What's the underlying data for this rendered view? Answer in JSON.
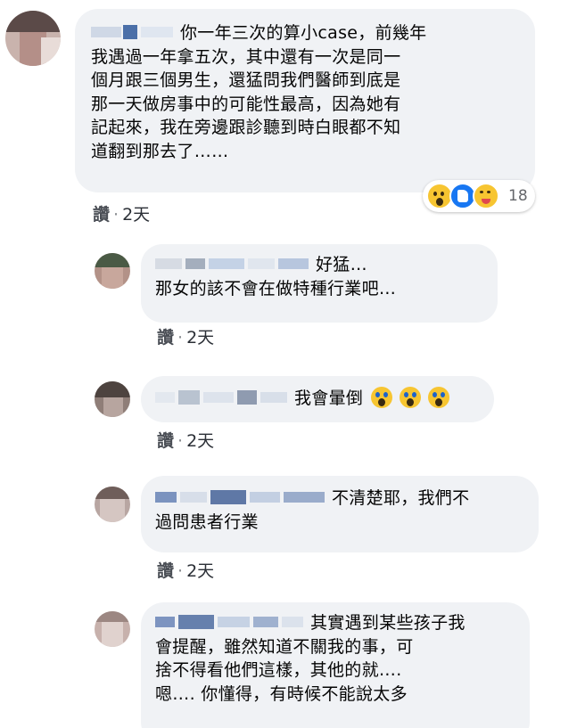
{
  "comments": [
    {
      "text_lines": [
        "你一年三次的算小case，前幾年",
        "我遇過一年拿五次，其中還有一次是同一",
        "個月跟三個男生，還猛問我們醫師到底是",
        "那一天做房事中的可能性最高，因為她有",
        "記起來，我在旁邊跟診聽到時白眼都不知",
        "道翻到那去了……"
      ],
      "like_label": "讚",
      "separator": "·",
      "time": "2天",
      "reaction_count": "18",
      "reaction_icons": [
        "wow-icon",
        "like-icon",
        "haha-icon"
      ]
    },
    {
      "text_lines": [
        "好猛…",
        "那女的該不會在做特種行業吧…"
      ],
      "like_label": "讚",
      "separator": "·",
      "time": "2天"
    },
    {
      "text_lines": [
        "我會暈倒"
      ],
      "emoji": [
        "scream-emoji",
        "scream-emoji",
        "scream-emoji"
      ],
      "like_label": "讚",
      "separator": "·",
      "time": "2天"
    },
    {
      "text_lines": [
        "不清楚耶，我們不",
        "過問患者行業"
      ],
      "like_label": "讚",
      "separator": "·",
      "time": "2天"
    },
    {
      "text_lines": [
        "其實遇到某些孩子我",
        "會提醒，雖然知道不關我的事，可",
        "捨不得看他們這樣，其他的就….",
        "嗯…. 你懂得，有時候不能說太多"
      ]
    }
  ],
  "colors": {
    "bubble": "#f0f2f5",
    "accent": "#1877f2",
    "text": "#050505",
    "meta": "#65676b"
  }
}
